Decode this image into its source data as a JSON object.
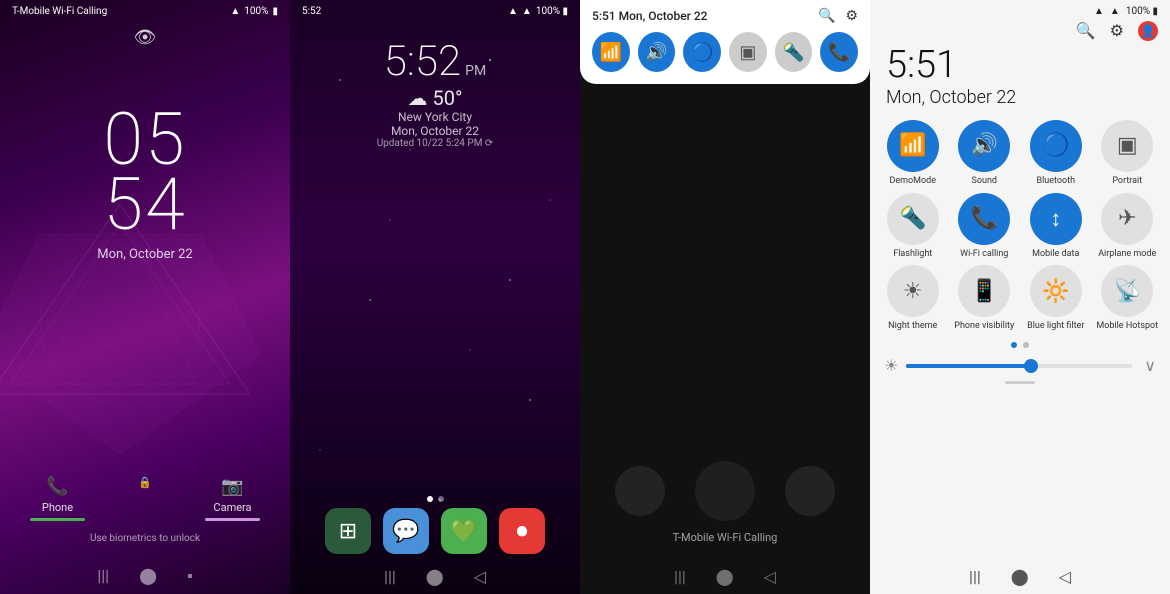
{
  "lock": {
    "carrier": "T-Mobile Wi-Fi Calling",
    "battery": "100%",
    "time": "05",
    "time2": "54",
    "date": "Mon, October 22",
    "phone_label": "Phone",
    "camera_label": "Camera",
    "biometric": "Use biometrics to unlock"
  },
  "home": {
    "time": "5:52",
    "period": "PM",
    "weather": "☁ 50°",
    "location": "New York City",
    "date": "Mon, October 22",
    "updated": "Updated 10/22 5:24 PM ⟳",
    "carrier_bottom": "T-Mobile Wi-Fi Calling"
  },
  "notif": {
    "time": "5:51 Mon, October 22",
    "carrier": "T-Mobile Wi-Fi Calling"
  },
  "qs": {
    "time": "5:51",
    "date": "Mon, October 22",
    "tiles": [
      {
        "label": "DemoMode",
        "active": true,
        "icon": "📶"
      },
      {
        "label": "Sound",
        "active": true,
        "icon": "🔊"
      },
      {
        "label": "Bluetooth",
        "active": true,
        "icon": "🔵"
      },
      {
        "label": "Portrait",
        "active": false,
        "icon": "⬜"
      },
      {
        "label": "Flashlight",
        "active": false,
        "icon": "🔦"
      },
      {
        "label": "Wi-Fi calling",
        "active": true,
        "icon": "📞"
      },
      {
        "label": "Mobile data",
        "active": true,
        "icon": "⬆"
      },
      {
        "label": "Airplane mode",
        "active": false,
        "icon": "✈"
      },
      {
        "label": "Night theme",
        "active": false,
        "icon": "☀"
      },
      {
        "label": "Phone visibility",
        "active": false,
        "icon": "📱"
      },
      {
        "label": "Blue light filter",
        "active": false,
        "icon": "🔆"
      },
      {
        "label": "Mobile Hotspot",
        "active": false,
        "icon": "📡"
      }
    ]
  }
}
